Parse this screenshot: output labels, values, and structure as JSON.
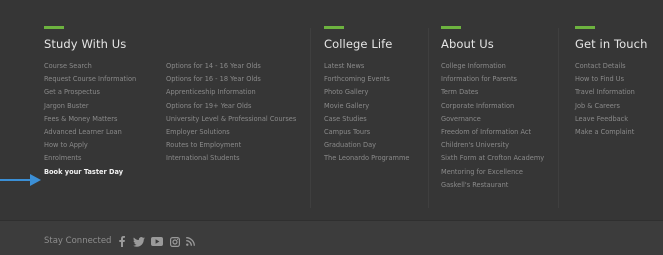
{
  "columns": [
    {
      "title": "Study With Us",
      "links": [
        "Course Search",
        "Request Course Information",
        "Get a Prospectus",
        "Jargon Buster",
        "Fees & Money Matters",
        "Advanced Learner Loan",
        "How to Apply",
        "Enrolments",
        "Book your Taster Day"
      ]
    },
    {
      "title": "",
      "links": [
        "Options for 14 - 16 Year Olds",
        "Options for 16 - 18 Year Olds",
        "Apprenticeship Information",
        "Options for 19+ Year Olds",
        "University Level & Professional Courses",
        "Employer Solutions",
        "Routes to Employment",
        "International Students"
      ]
    },
    {
      "title": "College Life",
      "links": [
        "Latest News",
        "Forthcoming Events",
        "Photo Gallery",
        "Movie Gallery",
        "Case Studies",
        "Campus Tours",
        "Graduation Day",
        "The Leonardo Programme"
      ]
    },
    {
      "title": "About Us",
      "links": [
        "College Information",
        "Information for Parents",
        "Term Dates",
        "Corporate Information",
        "Governance",
        "Freedom of Information Act",
        "Children's University",
        "Sixth Form at Crofton Academy",
        "Mentoring for Excellence",
        "Gaskell's Restaurant"
      ]
    },
    {
      "title": "Get in Touch",
      "links": [
        "Contact Details",
        "How to Find Us",
        "Travel Information",
        "Job & Careers",
        "Leave Feedback",
        "Make a Complaint"
      ]
    }
  ],
  "footer_bottom": {
    "stay_connected": "Stay Connected",
    "social_icons": [
      "facebook-icon",
      "twitter-icon",
      "youtube-icon",
      "instagram-icon",
      "rss-icon"
    ]
  },
  "colors": {
    "accent": "#6db33f",
    "arrow": "#3b8fd6",
    "background": "#363636"
  }
}
